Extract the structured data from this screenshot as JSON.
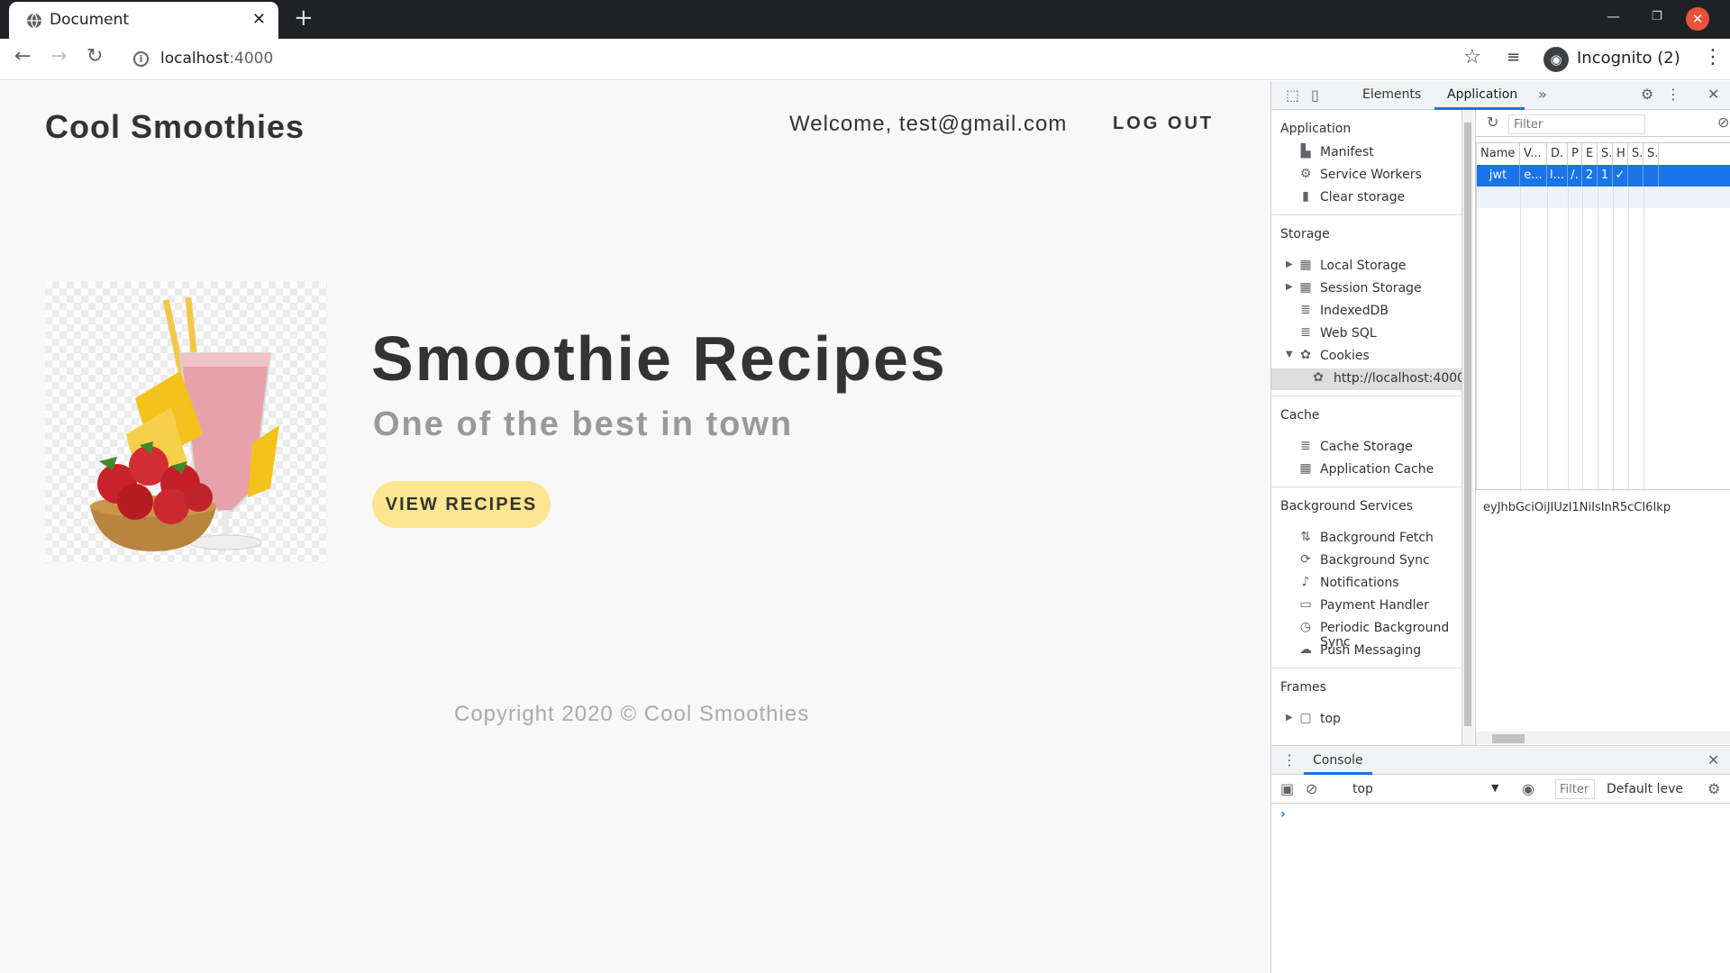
{
  "browser": {
    "tab_title": "Document",
    "url_host": "localhost",
    "url_port": ":4000",
    "profile_label": "Incognito (2)"
  },
  "site": {
    "title": "Cool Smoothies",
    "welcome": "Welcome, test@gmail.com",
    "logout_label": "LOG OUT",
    "hero_title": "Smoothie Recipes",
    "hero_subtitle": "One of the best in town",
    "hero_button": "VIEW RECIPES",
    "footer": "Copyright 2020 © Cool Smoothies"
  },
  "devtools": {
    "tabs": [
      "Elements",
      "Application"
    ],
    "sidebar": {
      "application": {
        "heading": "Application",
        "items": [
          "Manifest",
          "Service Workers",
          "Clear storage"
        ]
      },
      "storage": {
        "heading": "Storage",
        "items": [
          "Local Storage",
          "Session Storage",
          "IndexedDB",
          "Web SQL",
          "Cookies",
          "http://localhost:4000"
        ]
      },
      "cache": {
        "heading": "Cache",
        "items": [
          "Cache Storage",
          "Application Cache"
        ]
      },
      "background": {
        "heading": "Background Services",
        "items": [
          "Background Fetch",
          "Background Sync",
          "Notifications",
          "Payment Handler",
          "Periodic Background Sync",
          "Push Messaging"
        ]
      },
      "frames": {
        "heading": "Frames",
        "items": [
          "top"
        ]
      }
    },
    "cookies": {
      "filter_placeholder": "Filter",
      "columns": [
        "Name",
        "V...",
        "D.",
        "P",
        "E",
        "S.",
        "H",
        "S.",
        "S."
      ],
      "row": [
        "jwt",
        "e...",
        "l...",
        "/.",
        "2",
        "1",
        "✓",
        "",
        ""
      ],
      "value_preview": "eyJhbGciOiJIUzI1NiIsInR5cCI6Ikp"
    },
    "console": {
      "tab": "Console",
      "context": "top",
      "filter_placeholder": "Filter",
      "level": "Default leve",
      "prompt": "›"
    }
  }
}
